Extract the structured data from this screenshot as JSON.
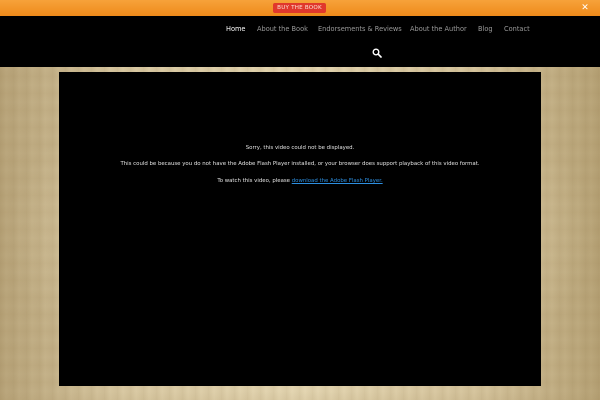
{
  "promo": {
    "button_label": "BUY THE BOOK"
  },
  "nav": {
    "items": [
      {
        "label": "Home",
        "active": true
      },
      {
        "label": "About the Book",
        "active": false
      },
      {
        "label": "Endorsements & Reviews",
        "active": false
      },
      {
        "label": "About the Author",
        "active": false
      },
      {
        "label": "Blog",
        "active": false
      },
      {
        "label": "Contact",
        "active": false
      }
    ]
  },
  "video": {
    "line1": "Sorry, this video could not be displayed.",
    "line2": "This could be because you do not have the Adobe Flash Player installed, or your browser does support playback of this video format.",
    "line3_prefix": "To watch this video, please ",
    "line3_link": "download the Adobe Flash Player."
  },
  "icons": {
    "close": "close-icon",
    "search": "search-icon"
  },
  "colors": {
    "promo_bar": "#f09020",
    "promo_button": "#e0382c",
    "nav_active": "#ffffff",
    "nav_inactive": "#9a9a9a",
    "link": "#2d8fe0"
  }
}
